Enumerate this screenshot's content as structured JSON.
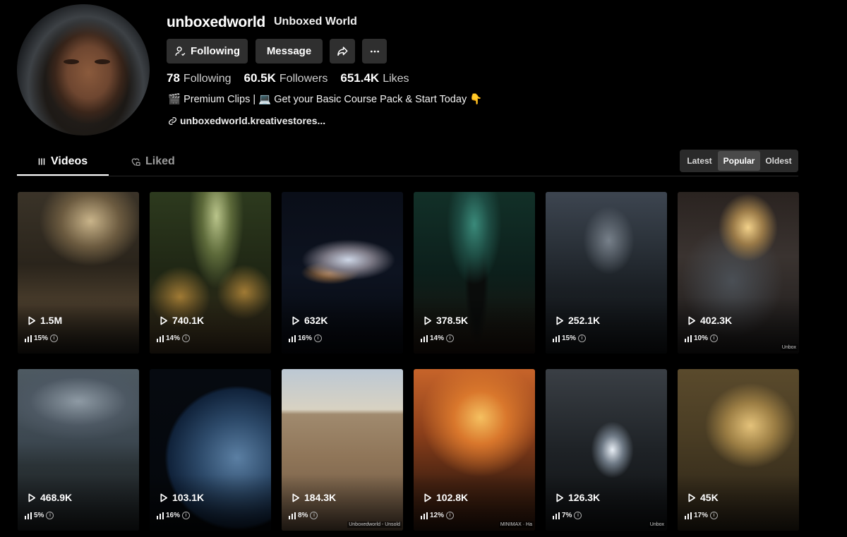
{
  "profile": {
    "username": "unboxedworld",
    "display_name": "Unboxed World",
    "following_button": "Following",
    "message_button": "Message",
    "stats": {
      "following_count": "78",
      "following_label": "Following",
      "followers_count": "60.5K",
      "followers_label": "Followers",
      "likes_count": "651.4K",
      "likes_label": "Likes"
    },
    "bio": "🎬 Premium Clips | 💻 Get your Basic Course Pack & Start Today 👇",
    "link": "unboxedworld.kreativestores..."
  },
  "tabs": {
    "videos": "Videos",
    "liked": "Liked"
  },
  "sort": {
    "latest": "Latest",
    "popular": "Popular",
    "oldest": "Oldest",
    "selected": "Popular"
  },
  "videos": [
    {
      "views": "1.5M",
      "pct": "15%"
    },
    {
      "views": "740.1K",
      "pct": "14%"
    },
    {
      "views": "632K",
      "pct": "16%"
    },
    {
      "views": "378.5K",
      "pct": "14%"
    },
    {
      "views": "252.1K",
      "pct": "15%"
    },
    {
      "views": "402.3K",
      "pct": "10%",
      "watermark": "Unbox"
    },
    {
      "views": "468.9K",
      "pct": "5%"
    },
    {
      "views": "103.1K",
      "pct": "16%"
    },
    {
      "views": "184.3K",
      "pct": "8%",
      "watermark": "Unboxedworld - Unsold"
    },
    {
      "views": "102.8K",
      "pct": "12%",
      "watermark": "MINIMAX · Ha"
    },
    {
      "views": "126.3K",
      "pct": "7%",
      "watermark": "Unbox"
    },
    {
      "views": "45K",
      "pct": "17%"
    }
  ],
  "colors": {
    "background": "#000000",
    "button": "#2f2f2f",
    "active_sort": "#4a4a4a"
  }
}
